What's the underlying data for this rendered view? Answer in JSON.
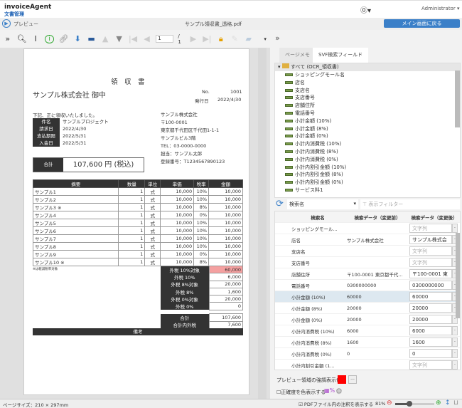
{
  "app": {
    "name": "invoiceAgent",
    "subtitle": "文書管理",
    "help_icon": "help-icon",
    "user": "Administrator"
  },
  "bar": {
    "preview_label": "プレビュー",
    "file_name": "サンプル領収書_透格.pdf",
    "back_button": "メイン画面に戻る"
  },
  "viewer": {
    "page_input": "1",
    "page_total": "/ 1",
    "page_size": "ページサイズ：210 × 297mm",
    "show_annotations": "PDFファイル内の注釈を表示する",
    "zoom": "81%"
  },
  "document": {
    "title": "領　収　書",
    "customer": "サンプル株式会社 御中",
    "no_label": "No.",
    "no_value": "1001",
    "date_label": "発行日",
    "date_value": "2022/4/30",
    "intro": "下記、正に領収いたしました。",
    "meta": [
      {
        "label": "件名",
        "value": "サンプルプロジェクト"
      },
      {
        "label": "請求日",
        "value": "2022/4/30"
      },
      {
        "label": "支払期限",
        "value": "2022/5/31"
      },
      {
        "label": "入金日",
        "value": "2022/5/31"
      }
    ],
    "issuer": [
      "サンプル株式会社",
      "〒100-0001",
      "東京都千代田区千代田1-1-1",
      "サンプルビル3階",
      "TEL：03-0000-0000",
      "担当：サンプル太郎",
      "登録番号：T1234567890123"
    ],
    "total_label": "合計",
    "total_value": "107,600 円 (税込)",
    "columns": [
      "摘要",
      "数量",
      "単位",
      "単価",
      "税率",
      "金額"
    ],
    "items": [
      [
        "サンプル1",
        "1",
        "式",
        "10,000",
        "10%",
        "10,000"
      ],
      [
        "サンプル2",
        "1",
        "式",
        "10,000",
        "10%",
        "10,000"
      ],
      [
        "サンプル3 ※",
        "1",
        "式",
        "10,000",
        "8%",
        "10,000"
      ],
      [
        "サンプル4",
        "1",
        "式",
        "10,000",
        "0%",
        "10,000"
      ],
      [
        "サンプル5",
        "1",
        "式",
        "10,000",
        "10%",
        "10,000"
      ],
      [
        "サンプル6",
        "1",
        "式",
        "10,000",
        "10%",
        "10,000"
      ],
      [
        "サンプル7",
        "1",
        "式",
        "10,000",
        "10%",
        "10,000"
      ],
      [
        "サンプル8",
        "1",
        "式",
        "10,000",
        "10%",
        "10,000"
      ],
      [
        "サンプル9",
        "1",
        "式",
        "10,000",
        "0%",
        "10,000"
      ],
      [
        "サンプル10 ※",
        "1",
        "式",
        "10,000",
        "8%",
        "10,000"
      ]
    ],
    "note": "※は軽減税率対象",
    "tax": [
      {
        "label": "外税 10%対象",
        "value": "60,000"
      },
      {
        "label": "外税 10%",
        "value": "6,000"
      },
      {
        "label": "外税 8%対象",
        "value": "20,000"
      },
      {
        "label": "外税 8%",
        "value": "1,600"
      },
      {
        "label": "外税 0%対象",
        "value": "20,000"
      },
      {
        "label": "外税 0%",
        "value": "0"
      }
    ],
    "sum": [
      {
        "label": "合計",
        "value": "107,600"
      },
      {
        "label": "合計内外税",
        "value": "7,600"
      }
    ],
    "remarks": "備考",
    "highlight_color": "#f4a0a0"
  },
  "panel": {
    "tabs": [
      "ページメモ",
      "SVF検索フィールド"
    ],
    "tree_root": "すべて (OCR_領収書)",
    "tree": [
      "ショッピングモール名",
      "店名",
      "支店名",
      "支店番号",
      "店舗住所",
      "電話番号",
      "小計金額 (10%)",
      "小計金額 (8%)",
      "小計金額 (0%)",
      "小計内消費税 (10%)",
      "小計内消費税 (8%)",
      "小計内消費税 (0%)",
      "小計内割引金額 (10%)",
      "小計内割引金額 (8%)",
      "小計内割引金額 (0%)",
      "サービス料1"
    ],
    "search_select": "検索名",
    "filter_placeholder": "表示フィルター",
    "grid_headers": [
      "検索名",
      "検索データ（変更前）",
      "検索データ（変更後）"
    ],
    "grid": [
      {
        "name": "ショッピングモール...",
        "before": "",
        "after": "",
        "ph": "文字列"
      },
      {
        "name": "店名",
        "before": "サンプル株式会社",
        "after": "サンプル株式会",
        "ph": ""
      },
      {
        "name": "支店名",
        "before": "",
        "after": "",
        "ph": "文字列"
      },
      {
        "name": "支店番号",
        "before": "",
        "after": "",
        "ph": "文字列"
      },
      {
        "name": "店舗住所",
        "before": "〒100-0001 東京都千代...",
        "after": "〒100-0001 東",
        "ph": ""
      },
      {
        "name": "電話番号",
        "before": "0300000000",
        "after": "0300000000",
        "ph": ""
      },
      {
        "name": "小計金額 (10%)",
        "before": "60000",
        "after": "60000",
        "ph": ""
      },
      {
        "name": "小計金額 (8%)",
        "before": "20000",
        "after": "20000",
        "ph": ""
      },
      {
        "name": "小計金額 (0%)",
        "before": "20000",
        "after": "20000",
        "ph": ""
      },
      {
        "name": "小計内消費税 (10%)",
        "before": "6000",
        "after": "6000",
        "ph": ""
      },
      {
        "name": "小計内消費税 (8%)",
        "before": "1600",
        "after": "1600",
        "ph": ""
      },
      {
        "name": "小計内消費税 (0%)",
        "before": "0",
        "after": "0",
        "ph": ""
      },
      {
        "name": "小計内割引金額 (1...",
        "before": "",
        "after": "",
        "ph": "文字列"
      }
    ],
    "highlight_label": "プレビュー領域の強調表示色",
    "highlight_color": "#ff0000",
    "accuracy_label": "正確度を色表示する"
  },
  "colors": {
    "accent": "#3a7fc8"
  }
}
